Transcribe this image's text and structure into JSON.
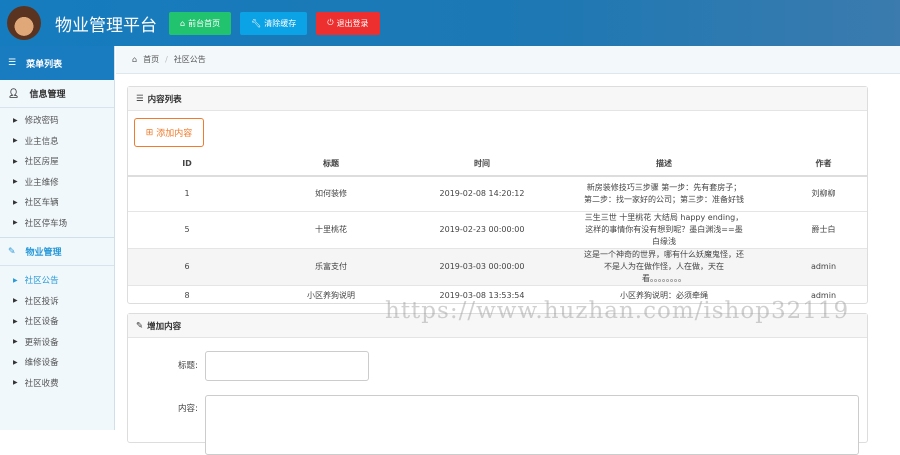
{
  "header": {
    "title": "物业管理平台",
    "buttons": [
      {
        "label": "前台首页",
        "icon": "home-icon",
        "color": "#22c36f"
      },
      {
        "label": "清除缓存",
        "icon": "wrench-icon",
        "color": "#0ba3e6"
      },
      {
        "label": "退出登录",
        "icon": "power-icon",
        "color": "#ee2f2f"
      }
    ]
  },
  "sidebar": {
    "title": "菜单列表",
    "groups": [
      {
        "label": "信息管理",
        "items": [
          "修改密码",
          "业主信息",
          "社区房屋",
          "业主维修",
          "社区车辆",
          "社区停车场"
        ]
      },
      {
        "label": "物业管理",
        "items": [
          "社区公告",
          "社区投诉",
          "社区设备",
          "更新设备",
          "维修设备",
          "社区收费"
        ]
      }
    ]
  },
  "breadcrumb": {
    "home": "首页",
    "sep": "/",
    "current": "社区公告"
  },
  "list_panel": {
    "title": "内容列表",
    "add_label": "添加内容",
    "columns": [
      "ID",
      "标题",
      "时间",
      "描述",
      "作者"
    ],
    "rows": [
      [
        "1",
        "如何装修",
        "2019-02-08 14:20:12",
        "新房装修技巧三步骤 第一步：先有套房子；第二步：找一家好的公司；第三步：准备好钱",
        "刘柳柳"
      ],
      [
        "5",
        "十里桃花",
        "2019-02-23 00:00:00",
        "三生三世 十里桃花 大结局 happy ending，这样的事情你有没有想到呢？墨白渊浅==墨白缘浅",
        "爵士白"
      ],
      [
        "6",
        "乐富支付",
        "2019-03-03 00:00:00",
        "这是一个神奇的世界，哪有什么妖魔鬼怪，还不是人为在做作怪，人在做，天在看。。。。。。。。",
        "admin"
      ],
      [
        "8",
        "小区养狗说明",
        "2019-03-08 13:53:54",
        "小区养狗说明：必须牵绳",
        "admin"
      ]
    ]
  },
  "form_panel": {
    "title": "增加内容",
    "title_label": "标题:",
    "content_label": "内容:",
    "title_value": "",
    "content_value": ""
  },
  "watermark": "https://www.huzhan.com/ishop32119"
}
